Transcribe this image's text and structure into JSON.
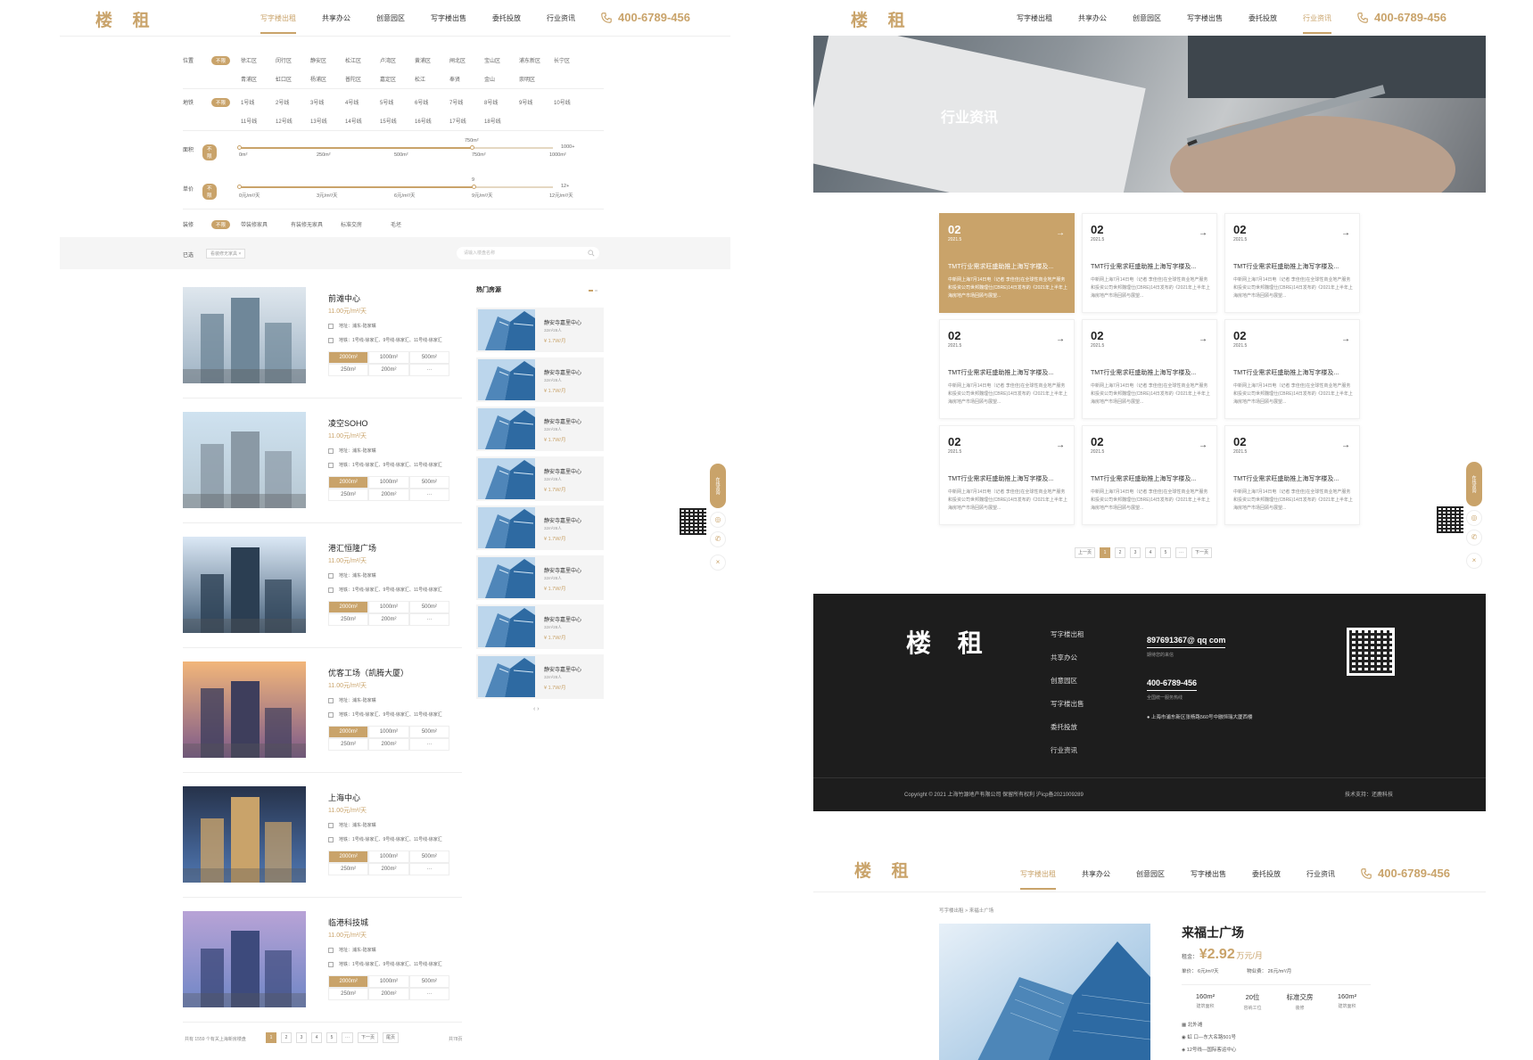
{
  "panel1": {
    "logo": "楼 租",
    "nav": [
      "写字楼出租",
      "共享办公",
      "创意园区",
      "写字楼出售",
      "委托投放",
      "行业资讯"
    ],
    "nav_active": 0,
    "phone": "400-6789-456",
    "filters": {
      "location": {
        "label": "位置",
        "all": "不限",
        "options": [
          "徐汇区",
          "闵行区",
          "静安区",
          "松江区",
          "卢湾区",
          "黄浦区",
          "闸北区",
          "宝山区",
          "浦东新区",
          "长宁区",
          "青浦区",
          "虹口区",
          "杨浦区",
          "普陀区",
          "嘉定区",
          "松江",
          "奉贤",
          "金山",
          "崇明区"
        ]
      },
      "metro": {
        "label": "地铁",
        "all": "不限",
        "options": [
          "1号线",
          "2号线",
          "3号线",
          "4号线",
          "5号线",
          "6号线",
          "7号线",
          "8号线",
          "9号线",
          "10号线",
          "11号线",
          "12号线",
          "13号线",
          "14号线",
          "15号线",
          "16号线",
          "17号线",
          "18号线"
        ]
      },
      "area": {
        "label": "面积",
        "all": "不限",
        "ticks": [
          "0m²",
          "250m²",
          "500m²",
          "750m²",
          "1000m²"
        ],
        "max": "1000+",
        "selected": "750m²"
      },
      "unit_price": {
        "label": "单价",
        "all": "不限",
        "ticks": [
          "0元/m²/天",
          "3元/m²/天",
          "6元/m²/天",
          "9元/m²/天",
          "12元/m²/天"
        ],
        "max": "12+",
        "selected": "9"
      },
      "decoration": {
        "label": "装修",
        "all": "不限",
        "options": [
          "带装修家具",
          "有装修无家具",
          "标准交房",
          "毛坯"
        ]
      }
    },
    "selected_label": "已选",
    "selected_chip": "看装修无家具 ×",
    "search_placeholder": "请输入楼盘名称",
    "listings": [
      {
        "name": "前滩中心",
        "price": "11.00元/m²/天",
        "addr_label": "地址：",
        "addr": "浦东-陆家嘴",
        "metro_label": "地铁：",
        "metro": "1号线-徐家汇、9号线-徐家汇、11号线-徐家汇",
        "sizes": [
          "2000m²",
          "1000m²",
          "500m²",
          "250m²",
          "200m²",
          "···"
        ]
      },
      {
        "name": "凌空SOHO",
        "price": "11.00元/m²/天",
        "addr_label": "地址：",
        "addr": "浦东-陆家嘴",
        "metro_label": "地铁：",
        "metro": "1号线-徐家汇、9号线-徐家汇、11号线-徐家汇",
        "sizes": [
          "2000m²",
          "1000m²",
          "500m²",
          "250m²",
          "200m²",
          "···"
        ]
      },
      {
        "name": "港汇恒隆广场",
        "price": "11.00元/m²/天",
        "addr_label": "地址：",
        "addr": "浦东-陆家嘴",
        "metro_label": "地铁：",
        "metro": "1号线-徐家汇、9号线-徐家汇、11号线-徐家汇",
        "sizes": [
          "2000m²",
          "1000m²",
          "500m²",
          "250m²",
          "200m²",
          "···"
        ]
      },
      {
        "name": "优客工场（凯腾大厦）",
        "price": "11.00元/m²/天",
        "addr_label": "地址：",
        "addr": "浦东-陆家嘴",
        "metro_label": "地铁：",
        "metro": "1号线-徐家汇、9号线-徐家汇、11号线-徐家汇",
        "sizes": [
          "2000m²",
          "1000m²",
          "500m²",
          "250m²",
          "200m²",
          "···"
        ]
      },
      {
        "name": "上海中心",
        "price": "11.00元/m²/天",
        "addr_label": "地址：",
        "addr": "浦东-陆家嘴",
        "metro_label": "地铁：",
        "metro": "1号线-徐家汇、9号线-徐家汇、11号线-徐家汇",
        "sizes": [
          "2000m²",
          "1000m²",
          "500m²",
          "250m²",
          "200m²",
          "···"
        ]
      },
      {
        "name": "临港科技城",
        "price": "11.00元/m²/天",
        "addr_label": "地址：",
        "addr": "浦东-陆家嘴",
        "metro_label": "地铁：",
        "metro": "1号线-徐家汇、9号线-徐家汇、11号线-徐家汇",
        "sizes": [
          "2000m²",
          "1000m²",
          "500m²",
          "250m²",
          "200m²",
          "···"
        ]
      }
    ],
    "hot_title": "热门房源",
    "hot": [
      {
        "name": "静安寺嘉里中心",
        "area": "32m²28人",
        "price": "¥ 1.7W/月"
      },
      {
        "name": "静安寺嘉里中心",
        "area": "32m²28人",
        "price": "¥ 1.7W/月"
      },
      {
        "name": "静安寺嘉里中心",
        "area": "32m²28人",
        "price": "¥ 1.7W/月"
      },
      {
        "name": "静安寺嘉里中心",
        "area": "32m²28人",
        "price": "¥ 1.7W/月"
      },
      {
        "name": "静安寺嘉里中心",
        "area": "32m²28人",
        "price": "¥ 1.7W/月"
      },
      {
        "name": "静安寺嘉里中心",
        "area": "32m²28人",
        "price": "¥ 1.7W/月"
      },
      {
        "name": "静安寺嘉里中心",
        "area": "32m²28人",
        "price": "¥ 1.7W/月"
      },
      {
        "name": "静安寺嘉里中心",
        "area": "32m²28人",
        "price": "¥ 1.7W/月"
      }
    ],
    "total_text": "共有 1559 个有关上海新房楼盘",
    "pages": [
      "1",
      "2",
      "3",
      "4",
      "5",
      "···",
      "下一页",
      "尾页"
    ],
    "page_count": "共78页",
    "side_consult": "在线咨询"
  },
  "panel2": {
    "logo": "楼 租",
    "nav": [
      "写字楼出租",
      "共享办公",
      "创意园区",
      "写字楼出售",
      "委托投放",
      "行业资讯"
    ],
    "nav_active": 5,
    "phone": "400-6789-456",
    "banner_title": "行业资讯",
    "news": [
      {
        "day": "02",
        "date": "2021.5",
        "title": "TMT行业需求旺盛助推上海写字楼及...",
        "body": "中新网上海7月14日电（记者 李佳佳)在全球性商业地产服务和投资公司世邦魏理仕(CBRE)14日发布的《2021年上半年上海房地产市场回顾与展望..."
      },
      {
        "day": "02",
        "date": "2021.5",
        "title": "TMT行业需求旺盛助推上海写字楼及...",
        "body": "中新网上海7月14日电（记者 李佳佳)在全球性商业地产服务和投资公司世邦魏理仕(CBRE)14日发布的《2021年上半年上海房地产市场回顾与展望..."
      },
      {
        "day": "02",
        "date": "2021.5",
        "title": "TMT行业需求旺盛助推上海写字楼及...",
        "body": "中新网上海7月14日电（记者 李佳佳)在全球性商业地产服务和投资公司世邦魏理仕(CBRE)14日发布的《2021年上半年上海房地产市场回顾与展望..."
      },
      {
        "day": "02",
        "date": "2021.5",
        "title": "TMT行业需求旺盛助推上海写字楼及...",
        "body": "中新网上海7月14日电（记者 李佳佳)在全球性商业地产服务和投资公司世邦魏理仕(CBRE)14日发布的《2021年上半年上海房地产市场回顾与展望..."
      },
      {
        "day": "02",
        "date": "2021.5",
        "title": "TMT行业需求旺盛助推上海写字楼及...",
        "body": "中新网上海7月14日电（记者 李佳佳)在全球性商业地产服务和投资公司世邦魏理仕(CBRE)14日发布的《2021年上半年上海房地产市场回顾与展望..."
      },
      {
        "day": "02",
        "date": "2021.5",
        "title": "TMT行业需求旺盛助推上海写字楼及...",
        "body": "中新网上海7月14日电（记者 李佳佳)在全球性商业地产服务和投资公司世邦魏理仕(CBRE)14日发布的《2021年上半年上海房地产市场回顾与展望..."
      },
      {
        "day": "02",
        "date": "2021.5",
        "title": "TMT行业需求旺盛助推上海写字楼及...",
        "body": "中新网上海7月14日电（记者 李佳佳)在全球性商业地产服务和投资公司世邦魏理仕(CBRE)14日发布的《2021年上半年上海房地产市场回顾与展望..."
      },
      {
        "day": "02",
        "date": "2021.5",
        "title": "TMT行业需求旺盛助推上海写字楼及...",
        "body": "中新网上海7月14日电（记者 李佳佳)在全球性商业地产服务和投资公司世邦魏理仕(CBRE)14日发布的《2021年上半年上海房地产市场回顾与展望..."
      },
      {
        "day": "02",
        "date": "2021.5",
        "title": "TMT行业需求旺盛助推上海写字楼及...",
        "body": "中新网上海7月14日电（记者 李佳佳)在全球性商业地产服务和投资公司世邦魏理仕(CBRE)14日发布的《2021年上半年上海房地产市场回顾与展望..."
      }
    ],
    "pages": [
      "上一页",
      "1",
      "2",
      "3",
      "4",
      "5",
      "···",
      "下一页"
    ],
    "footer": {
      "logo": "楼 租",
      "links": [
        "写字楼出租",
        "共享办公",
        "创意园区",
        "写字楼出售",
        "委托投放",
        "行业资讯"
      ],
      "email": "897691367@ qq com",
      "email_sub": "期待您的来信",
      "phone": "400-6789-456",
      "phone_sub": "全国统一服务热线",
      "address": "上海市浦东新区张杨路560号中融恒瑞大厦西楼",
      "copyright": "Copyright © 2021  上海竹源地产有限公司    保留所有权利    沪icp备2021009289",
      "tech": "技术支持：还鹿科技"
    }
  },
  "panel3": {
    "logo": "楼 租",
    "nav": [
      "写字楼出租",
      "共享办公",
      "创意园区",
      "写字楼出售",
      "委托投放",
      "行业资讯"
    ],
    "nav_active": 0,
    "phone": "400-6789-456",
    "breadcrumb": "写字楼出租 > 来福士广场",
    "name": "来福士广场",
    "rent_label": "租金：",
    "rent_value": "¥2.92",
    "rent_unit": "万元/月",
    "unit_price": "单价：  6元/m²/天",
    "property_fee": "物业费：  26元/m²/月",
    "stats": [
      {
        "value": "160m²",
        "label": "建筑面积"
      },
      {
        "value": "20位",
        "label": "容纳工位"
      },
      {
        "value": "标准交房",
        "label": "装修"
      },
      {
        "value": "160m²",
        "label": "建筑面积"
      }
    ],
    "district": "北外滩",
    "address": "虹 口—东大名路501号",
    "metro": "12号线—国际客运中心"
  }
}
